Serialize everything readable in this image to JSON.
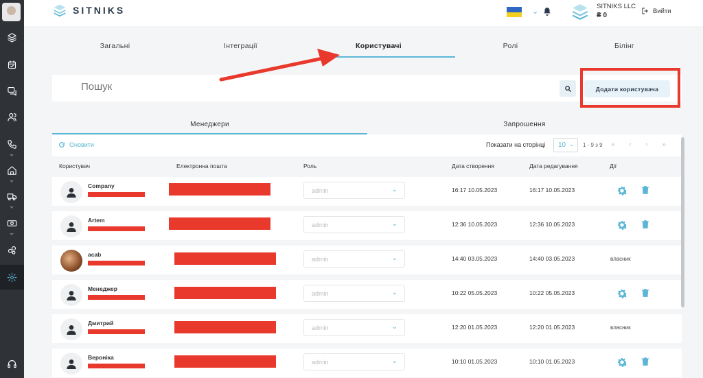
{
  "brand": {
    "name": "SITNIKS",
    "accent": "#5bb6d6",
    "annotation": "#e8392c"
  },
  "topbar": {
    "company_name": "SITNIKS LLC",
    "balance": "₴ 0",
    "logout_label": "Вийти"
  },
  "tabs": [
    {
      "label": "Загальні"
    },
    {
      "label": "Інтеграції"
    },
    {
      "label": "Користувачі",
      "active": true
    },
    {
      "label": "Ролі"
    },
    {
      "label": "Білінг"
    }
  ],
  "search": {
    "placeholder": "Пошук",
    "add_user_label": "Додати користувача"
  },
  "subtabs": [
    {
      "label": "Менеджери",
      "active": true
    },
    {
      "label": "Запрошення"
    }
  ],
  "table": {
    "refresh_label": "Оновити",
    "per_page_label": "Показати на сторінці",
    "per_page_value": "10",
    "range_label": "1 - 9 з 9",
    "columns": [
      "Користувач",
      "Електронна пошта",
      "Роль",
      "Дата створення",
      "Дата редагування",
      "Дії"
    ],
    "rows": [
      {
        "name": "Company",
        "role": "admin",
        "created": "16:17 10.05.2023",
        "updated": "16:17 10.05.2023",
        "owner": false
      },
      {
        "name": "Artem",
        "role": "admin",
        "created": "12:36 10.05.2023",
        "updated": "12:36 10.05.2023",
        "owner": false
      },
      {
        "name": "acab",
        "role": "admin",
        "created": "14:40 03.05.2023",
        "updated": "14:40 03.05.2023",
        "owner": true,
        "owner_label": "власник",
        "photo": true
      },
      {
        "name": "Менеджер",
        "role": "admin",
        "created": "10:22 05.05.2023",
        "updated": "10:22 05.05.2023",
        "owner": false
      },
      {
        "name": "Дмитрий",
        "role": "admin",
        "created": "12:20 01.05.2023",
        "updated": "12:20 01.05.2023",
        "owner": true,
        "owner_label": "власник"
      },
      {
        "name": "Вероніка",
        "role": "admin",
        "created": "10:10 01.05.2023",
        "updated": "10:10 01.05.2023",
        "owner": false
      }
    ]
  },
  "sidebar": {
    "items": [
      "layers-icon",
      "calendar-icon",
      "chat-icon",
      "users-icon",
      "phone-icon",
      "home-icon",
      "truck-icon",
      "money-icon",
      "gears-icon",
      "settings-icon",
      "headset-icon"
    ],
    "active": "settings-icon"
  }
}
